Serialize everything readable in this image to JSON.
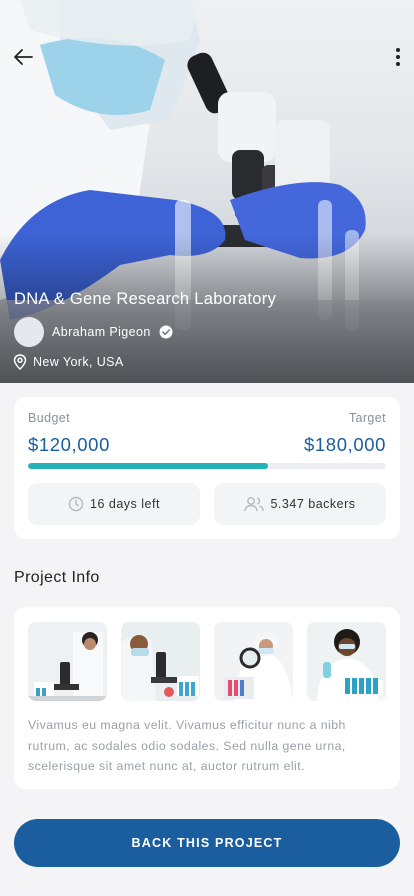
{
  "hero": {
    "title": "DNA & Gene Research Laboratory",
    "author": "Abraham Pigeon",
    "location": "New York, USA"
  },
  "funding": {
    "budget_label": "Budget",
    "target_label": "Target",
    "budget_value": "$120,000",
    "target_value": "$180,000",
    "progress_fraction": 0.67,
    "days_left": "16 days left",
    "backers": "5.347 backers"
  },
  "project_info": {
    "title": "Project Info",
    "description": "Vivamus eu magna velit. Vivamus efficitur nunc a nibh rutrum, ac sodales odio sodales. Sed nulla gene urna, scelerisque sit amet nunc at, auctor rutrum elit."
  },
  "cta": {
    "label": "BACK THIS PROJECT"
  },
  "colors": {
    "accent": "#1b5e9f",
    "progress": "#25b2b6",
    "background": "#f4f4f6"
  },
  "icons": [
    "back-arrow-icon",
    "more-vertical-icon",
    "verified-icon",
    "location-pin-icon",
    "clock-icon",
    "users-icon"
  ]
}
